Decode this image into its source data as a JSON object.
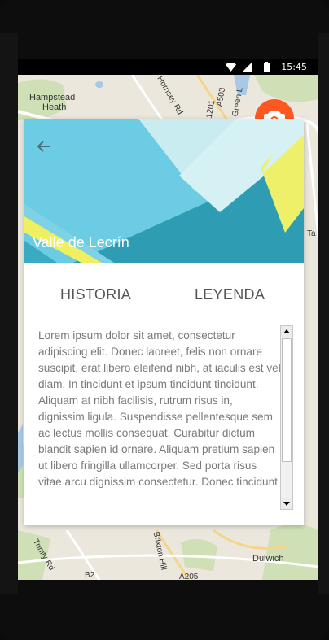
{
  "status_bar": {
    "time": "15:45",
    "icons": [
      "wifi-icon",
      "signal-icon",
      "battery-icon"
    ]
  },
  "map": {
    "labels": [
      "Hampstead",
      "Heath",
      "Hornsey Rd",
      "A503",
      "A1201",
      "Green L",
      "Brixton Hill",
      "Dulwich",
      "Trinity Rd",
      "B2",
      "A205",
      "Ta"
    ]
  },
  "fab": {
    "icon": "camera-icon",
    "color": "#ff5722"
  },
  "card": {
    "title": "Valle de Lecrín",
    "back_icon": "arrow-back-icon",
    "tabs": [
      "HISTORIA",
      "LEYENDA"
    ],
    "body_text": "Lorem ipsum dolor sit amet, consectetur adipiscing elit. Donec laoreet, felis non ornare suscipit, erat libero eleifend nibh, at iaculis est vel diam. In tincidunt et ipsum tincidunt tincidunt. Aliquam at nibh facilisis, rutrum risus in, dignissim ligula. Suspendisse pellentesque sem ac lectus mollis consequat. Curabitur dictum blandit sapien id ornare. Aliquam pretium sapien ut libero fringilla ullamcorper. Sed porta risus vitae arcu dignissim consectetur. Donec tincidunt"
  },
  "colors": {
    "hero_blue": "#58bdd8",
    "hero_teal": "#2f9fb5",
    "hero_yellow": "#f4f265",
    "text_gray": "#7a7a7a"
  }
}
